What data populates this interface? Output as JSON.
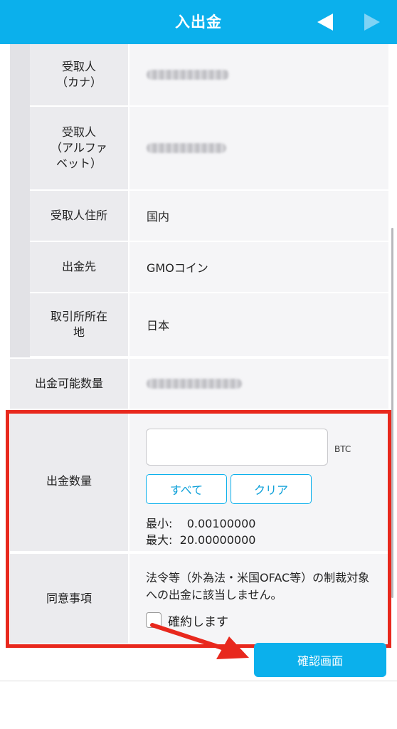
{
  "header": {
    "title": "入出金"
  },
  "rows": {
    "recipient_kana": {
      "label": "受取人\n（カナ）"
    },
    "recipient_alpha": {
      "label": "受取人\n（アルファ\nベット）"
    },
    "recipient_address": {
      "label": "受取人住所",
      "value": "国内"
    },
    "destination": {
      "label": "出金先",
      "value": "GMOコイン"
    },
    "exchange_location": {
      "label": "取引所所在\n地",
      "value": "日本"
    },
    "available_amount": {
      "label": "出金可能数量"
    }
  },
  "withdraw": {
    "label": "出金数量",
    "input_value": "",
    "unit": "BTC",
    "all_label": "すべて",
    "clear_label": "クリア",
    "min_text": "最小:    0.00100000",
    "max_text": "最大:  20.00000000"
  },
  "agreement": {
    "label": "同意事項",
    "notice": "法令等（外為法・米国OFAC等）の制裁対象への出金に該当しません。",
    "checkbox_label": "確約します"
  },
  "footer": {
    "confirm_label": "確認画面"
  },
  "colors": {
    "accent": "#0bb0ec",
    "highlight": "#e8281d"
  }
}
